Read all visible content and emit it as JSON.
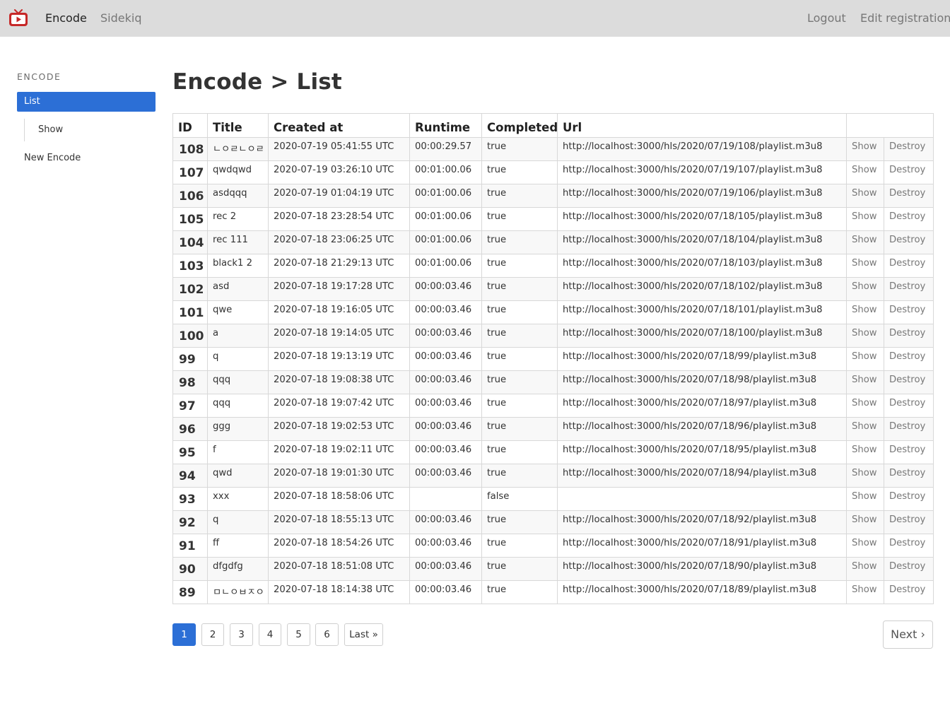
{
  "navbar": {
    "logo": "video-tv-logo-icon",
    "brand_color": "#c62828",
    "links": [
      "Encode",
      "Sidekiq"
    ],
    "right_links": [
      "Logout",
      "Edit registration"
    ]
  },
  "sidebar": {
    "heading": "ENCODE",
    "items": [
      {
        "label": "List",
        "active": true
      },
      {
        "label": "Show"
      },
      {
        "label": "New Encode"
      }
    ]
  },
  "page": {
    "title": "Encode > List"
  },
  "table": {
    "columns": [
      "ID",
      "Title",
      "Created at",
      "Runtime",
      "Completed",
      "Url",
      ""
    ],
    "rows": [
      {
        "id": "108",
        "title": "ㄴㅇㄹㄴㅇㄹ",
        "created_at": "2020-07-19 05:41:55 UTC",
        "runtime": "00:00:29.57",
        "completed": "true",
        "url": "http://localhost:3000/hls/2020/07/19/108/playlist.m3u8"
      },
      {
        "id": "107",
        "title": "qwdqwd",
        "created_at": "2020-07-19 03:26:10 UTC",
        "runtime": "00:01:00.06",
        "completed": "true",
        "url": "http://localhost:3000/hls/2020/07/19/107/playlist.m3u8"
      },
      {
        "id": "106",
        "title": "asdqqq",
        "created_at": "2020-07-19 01:04:19 UTC",
        "runtime": "00:01:00.06",
        "completed": "true",
        "url": "http://localhost:3000/hls/2020/07/19/106/playlist.m3u8"
      },
      {
        "id": "105",
        "title": "rec 2",
        "created_at": "2020-07-18 23:28:54 UTC",
        "runtime": "00:01:00.06",
        "completed": "true",
        "url": "http://localhost:3000/hls/2020/07/18/105/playlist.m3u8"
      },
      {
        "id": "104",
        "title": "rec 111",
        "created_at": "2020-07-18 23:06:25 UTC",
        "runtime": "00:01:00.06",
        "completed": "true",
        "url": "http://localhost:3000/hls/2020/07/18/104/playlist.m3u8"
      },
      {
        "id": "103",
        "title": "black1 2",
        "created_at": "2020-07-18 21:29:13 UTC",
        "runtime": "00:01:00.06",
        "completed": "true",
        "url": "http://localhost:3000/hls/2020/07/18/103/playlist.m3u8"
      },
      {
        "id": "102",
        "title": "asd",
        "created_at": "2020-07-18 19:17:28 UTC",
        "runtime": "00:00:03.46",
        "completed": "true",
        "url": "http://localhost:3000/hls/2020/07/18/102/playlist.m3u8"
      },
      {
        "id": "101",
        "title": "qwe",
        "created_at": "2020-07-18 19:16:05 UTC",
        "runtime": "00:00:03.46",
        "completed": "true",
        "url": "http://localhost:3000/hls/2020/07/18/101/playlist.m3u8"
      },
      {
        "id": "100",
        "title": "a",
        "created_at": "2020-07-18 19:14:05 UTC",
        "runtime": "00:00:03.46",
        "completed": "true",
        "url": "http://localhost:3000/hls/2020/07/18/100/playlist.m3u8"
      },
      {
        "id": "99",
        "title": "q",
        "created_at": "2020-07-18 19:13:19 UTC",
        "runtime": "00:00:03.46",
        "completed": "true",
        "url": "http://localhost:3000/hls/2020/07/18/99/playlist.m3u8"
      },
      {
        "id": "98",
        "title": "qqq",
        "created_at": "2020-07-18 19:08:38 UTC",
        "runtime": "00:00:03.46",
        "completed": "true",
        "url": "http://localhost:3000/hls/2020/07/18/98/playlist.m3u8"
      },
      {
        "id": "97",
        "title": "qqq",
        "created_at": "2020-07-18 19:07:42 UTC",
        "runtime": "00:00:03.46",
        "completed": "true",
        "url": "http://localhost:3000/hls/2020/07/18/97/playlist.m3u8"
      },
      {
        "id": "96",
        "title": "ggg",
        "created_at": "2020-07-18 19:02:53 UTC",
        "runtime": "00:00:03.46",
        "completed": "true",
        "url": "http://localhost:3000/hls/2020/07/18/96/playlist.m3u8"
      },
      {
        "id": "95",
        "title": "f",
        "created_at": "2020-07-18 19:02:11 UTC",
        "runtime": "00:00:03.46",
        "completed": "true",
        "url": "http://localhost:3000/hls/2020/07/18/95/playlist.m3u8"
      },
      {
        "id": "94",
        "title": "qwd",
        "created_at": "2020-07-18 19:01:30 UTC",
        "runtime": "00:00:03.46",
        "completed": "true",
        "url": "http://localhost:3000/hls/2020/07/18/94/playlist.m3u8"
      },
      {
        "id": "93",
        "title": "xxx",
        "created_at": "2020-07-18 18:58:06 UTC",
        "runtime": "",
        "completed": "false",
        "url": ""
      },
      {
        "id": "92",
        "title": "q",
        "created_at": "2020-07-18 18:55:13 UTC",
        "runtime": "00:00:03.46",
        "completed": "true",
        "url": "http://localhost:3000/hls/2020/07/18/92/playlist.m3u8"
      },
      {
        "id": "91",
        "title": "ff",
        "created_at": "2020-07-18 18:54:26 UTC",
        "runtime": "00:00:03.46",
        "completed": "true",
        "url": "http://localhost:3000/hls/2020/07/18/91/playlist.m3u8"
      },
      {
        "id": "90",
        "title": "dfgdfg",
        "created_at": "2020-07-18 18:51:08 UTC",
        "runtime": "00:00:03.46",
        "completed": "true",
        "url": "http://localhost:3000/hls/2020/07/18/90/playlist.m3u8"
      },
      {
        "id": "89",
        "title": "ㅁㄴㅇㅂㅈㅇ",
        "created_at": "2020-07-18 18:14:38 UTC",
        "runtime": "00:00:03.46",
        "completed": "true",
        "url": "http://localhost:3000/hls/2020/07/18/89/playlist.m3u8"
      }
    ],
    "row_actions": [
      "Show",
      "Destroy"
    ]
  },
  "pagination": {
    "pages": [
      "1",
      "2",
      "3",
      "4",
      "5",
      "6"
    ],
    "current": "1",
    "last": "Last »",
    "next": "Next ›"
  },
  "colors": {
    "primary": "#2c6fd6",
    "navbar_bg": "#dcdcdc"
  }
}
